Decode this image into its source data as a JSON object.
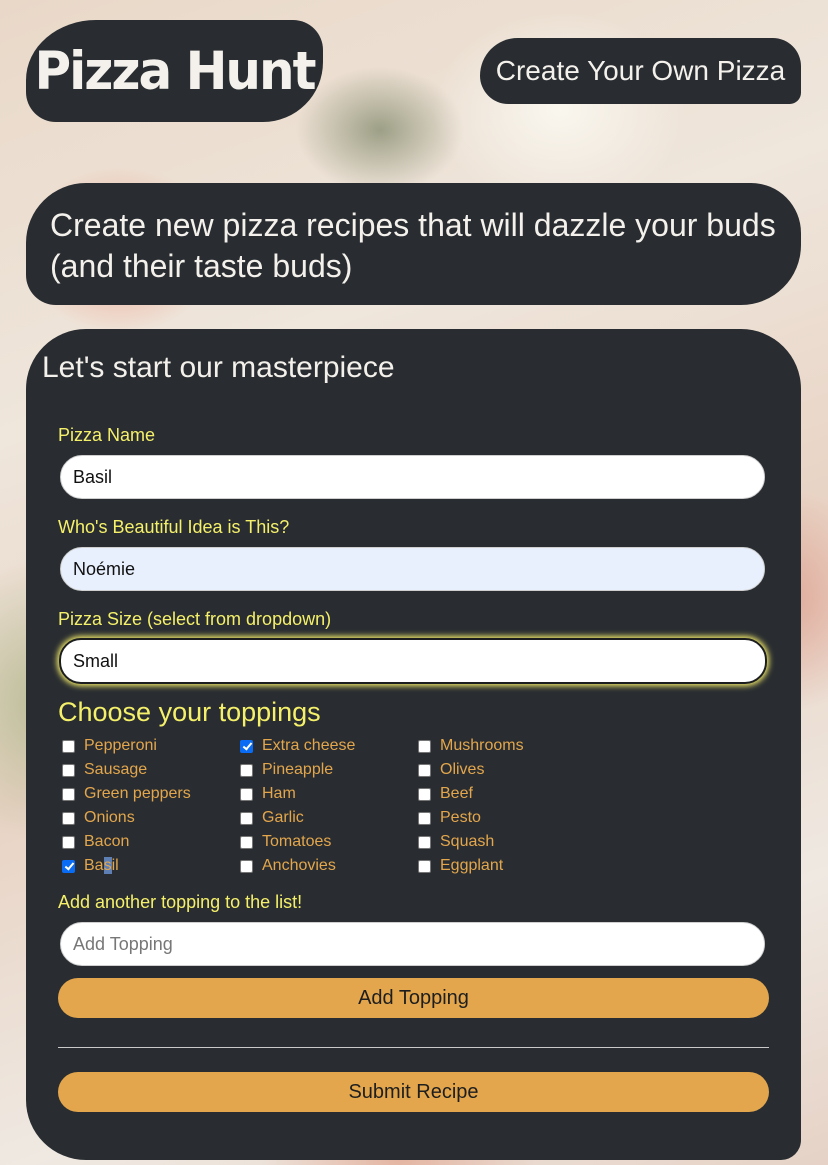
{
  "header": {
    "logo_text": "Pizza Hunt",
    "create_link": "Create Your Own Pizza"
  },
  "hero": {
    "tagline": "Create new pizza recipes that will dazzle your buds (and their taste buds)"
  },
  "form": {
    "title": "Let's start our masterpiece",
    "pizza_name": {
      "label": "Pizza Name",
      "value": "Basil"
    },
    "created_by": {
      "label": "Who's Beautiful Idea is This?",
      "value": "Noémie"
    },
    "size": {
      "label": "Pizza Size (select from dropdown)",
      "value": "Small"
    },
    "toppings_heading": "Choose your toppings",
    "toppings_columns": [
      [
        {
          "label": "Pepperoni",
          "checked": false
        },
        {
          "label": "Sausage",
          "checked": false
        },
        {
          "label": "Green peppers",
          "checked": false
        },
        {
          "label": "Onions",
          "checked": false
        },
        {
          "label": "Bacon",
          "checked": false
        },
        {
          "label": "Basil",
          "checked": true
        }
      ],
      [
        {
          "label": "Extra cheese",
          "checked": true
        },
        {
          "label": "Pineapple",
          "checked": false
        },
        {
          "label": "Ham",
          "checked": false
        },
        {
          "label": "Garlic",
          "checked": false
        },
        {
          "label": "Tomatoes",
          "checked": false
        },
        {
          "label": "Anchovies",
          "checked": false
        }
      ],
      [
        {
          "label": "Mushrooms",
          "checked": false
        },
        {
          "label": "Olives",
          "checked": false
        },
        {
          "label": "Beef",
          "checked": false
        },
        {
          "label": "Pesto",
          "checked": false
        },
        {
          "label": "Squash",
          "checked": false
        },
        {
          "label": "Eggplant",
          "checked": false
        }
      ]
    ],
    "add_topping": {
      "label": "Add another topping to the list!",
      "placeholder": "Add Topping",
      "button": "Add Topping"
    },
    "submit_button": "Submit Recipe"
  },
  "colors": {
    "panel": "#292d31",
    "label_yellow": "#f5f06a",
    "topping_orange": "#e3a64c",
    "button": "#e3a64c",
    "checkbox_checked": "#0a6cf4"
  }
}
